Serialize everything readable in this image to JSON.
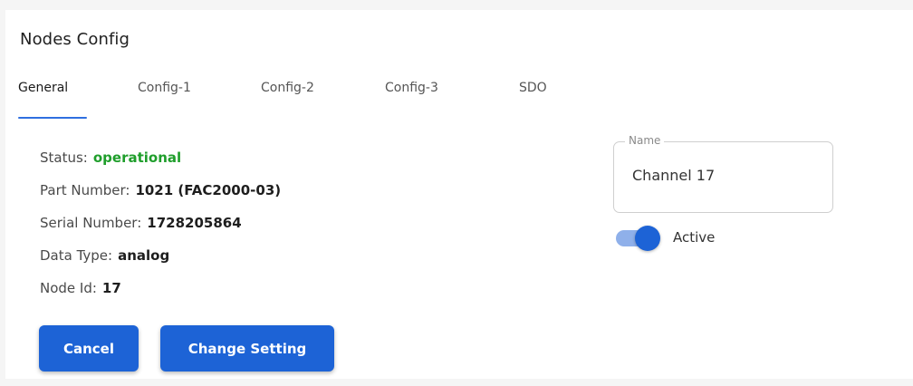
{
  "page": {
    "title": "Nodes Config"
  },
  "tabs": [
    {
      "label": "General",
      "active": true
    },
    {
      "label": "Config-1",
      "active": false
    },
    {
      "label": "Config-2",
      "active": false
    },
    {
      "label": "Config-3",
      "active": false
    },
    {
      "label": "SDO",
      "active": false
    }
  ],
  "info": {
    "status": {
      "label": "Status:",
      "value": "operational"
    },
    "part_number": {
      "label": "Part Number:",
      "value": "1021 (FAC2000-03)"
    },
    "serial_number": {
      "label": "Serial Number:",
      "value": "1728205864"
    },
    "data_type": {
      "label": "Data Type:",
      "value": "analog"
    },
    "node_id": {
      "label": "Node Id:",
      "value": "17"
    }
  },
  "name_field": {
    "label": "Name",
    "value": "Channel 17"
  },
  "active_toggle": {
    "label": "Active",
    "on": true
  },
  "buttons": {
    "cancel": "Cancel",
    "change_setting": "Change Setting"
  },
  "colors": {
    "accent": "#1d63d6",
    "status_ok": "#1f9e2b",
    "track": "#8fb0ea"
  }
}
